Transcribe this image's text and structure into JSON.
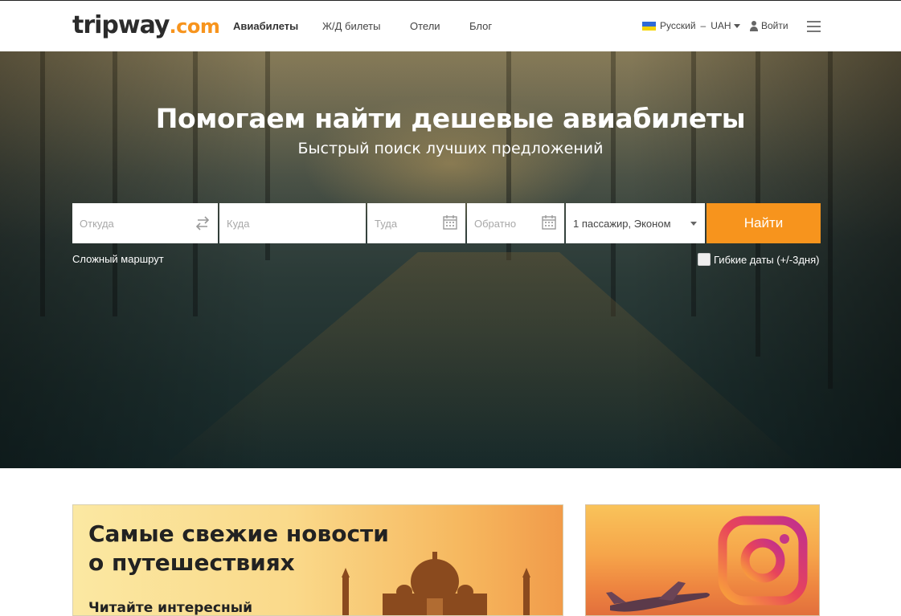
{
  "header": {
    "logo_main": "tripway",
    "logo_tld": ".com",
    "nav": [
      "Авиабилеты",
      "Ж/Д билеты",
      "Отели",
      "Блог"
    ],
    "language": "Русский",
    "separator": "–",
    "currency": "UAH",
    "login": "Войти"
  },
  "hero": {
    "title": "Помогаем найти дешевые авиабилеты",
    "subtitle": "Быстрый поиск лучших предложений"
  },
  "search": {
    "from_placeholder": "Откуда",
    "to_placeholder": "Куда",
    "depart_placeholder": "Туда",
    "return_placeholder": "Обратно",
    "passengers": "1 пассажир, Эконом",
    "submit": "Найти",
    "complex_route": "Сложный маршрут",
    "flexible_dates": "Гибкие даты (+/-3дня)"
  },
  "banners": {
    "news_title_line1": "Самые свежие новости",
    "news_title_line2": "о путешествиях",
    "news_subtitle": "Читайте интересный"
  },
  "colors": {
    "accent": "#f7941d",
    "logo_dark": "#2b2b2b"
  },
  "icons": [
    "ukraine-flag-icon",
    "user-icon",
    "hamburger-menu-icon",
    "swap-arrows-icon",
    "calendar-icon",
    "chevron-down-icon",
    "instagram-icon"
  ]
}
